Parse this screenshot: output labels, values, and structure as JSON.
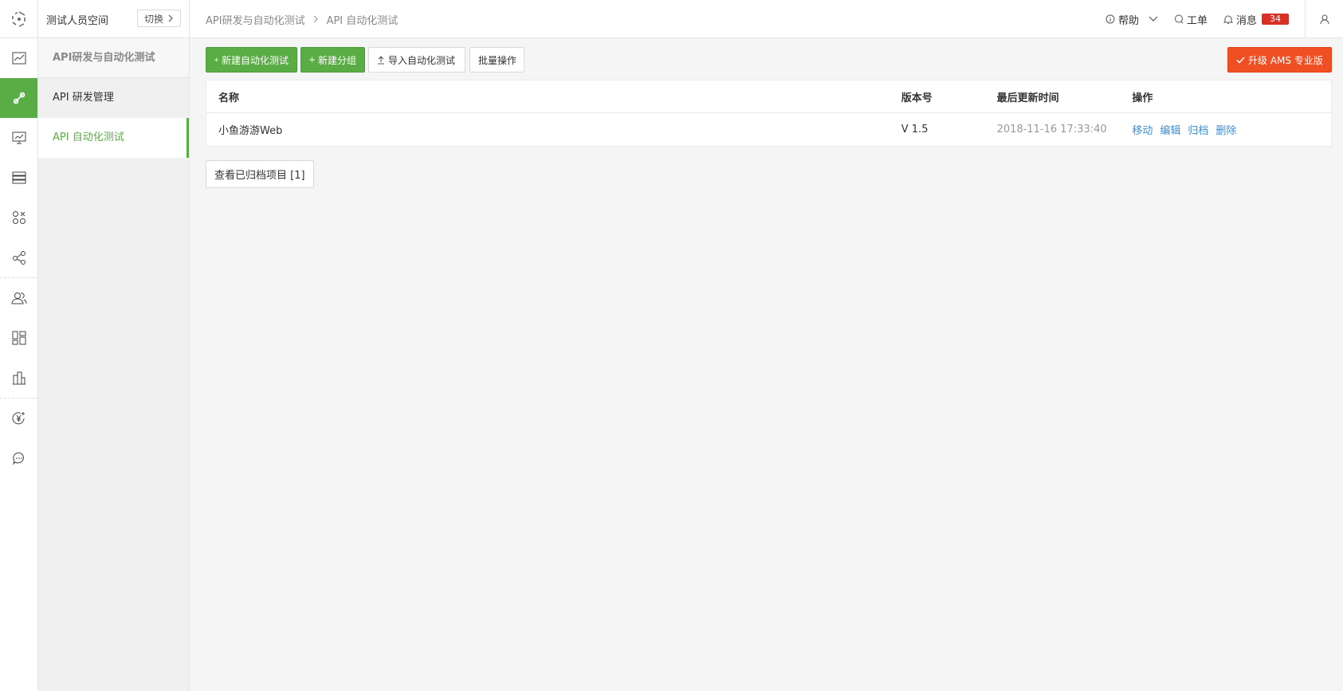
{
  "header": {
    "workspace_name": "测试人员空间",
    "switch_label": "切换",
    "breadcrumb": [
      "API研发与自动化测试",
      "API 自动化测试"
    ],
    "help_label": "帮助",
    "ticket_label": "工单",
    "messages_label": "消息",
    "messages_count": "34"
  },
  "rail": {
    "icons": [
      "dashboard-chart-icon",
      "api-link-icon",
      "monitor-icon",
      "database-icon",
      "apps-grid-icon",
      "share-icon",
      "team-icon",
      "widgets-icon",
      "buildings-icon",
      "billing-icon",
      "chat-icon"
    ],
    "active_index": 1,
    "accent": "#5aac44"
  },
  "subnav": {
    "title": "API研发与自动化测试",
    "items": [
      {
        "label": "API 研发管理",
        "active": false
      },
      {
        "label": "API 自动化测试",
        "active": true
      }
    ]
  },
  "toolbar": {
    "new_test_label": "新建自动化测试",
    "new_group_label": "新建分组",
    "import_label": "导入自动化测试",
    "batch_label": "批量操作",
    "upgrade_label": "升级 AMS 专业版"
  },
  "table": {
    "headers": {
      "name": "名称",
      "version": "版本号",
      "updated": "最后更新时间",
      "ops": "操作"
    },
    "rows": [
      {
        "name": "小鱼游游Web",
        "version": "V 1.5",
        "updated": "2018-11-16 17:33:40",
        "ops": [
          "移动",
          "编辑",
          "归档",
          "删除"
        ]
      }
    ]
  },
  "archived_label": "查看已归档项目 [1]",
  "colors": {
    "green": "#5aac44",
    "orange": "#f04e23",
    "link": "#3b8fd6",
    "badge": "#d93026"
  }
}
